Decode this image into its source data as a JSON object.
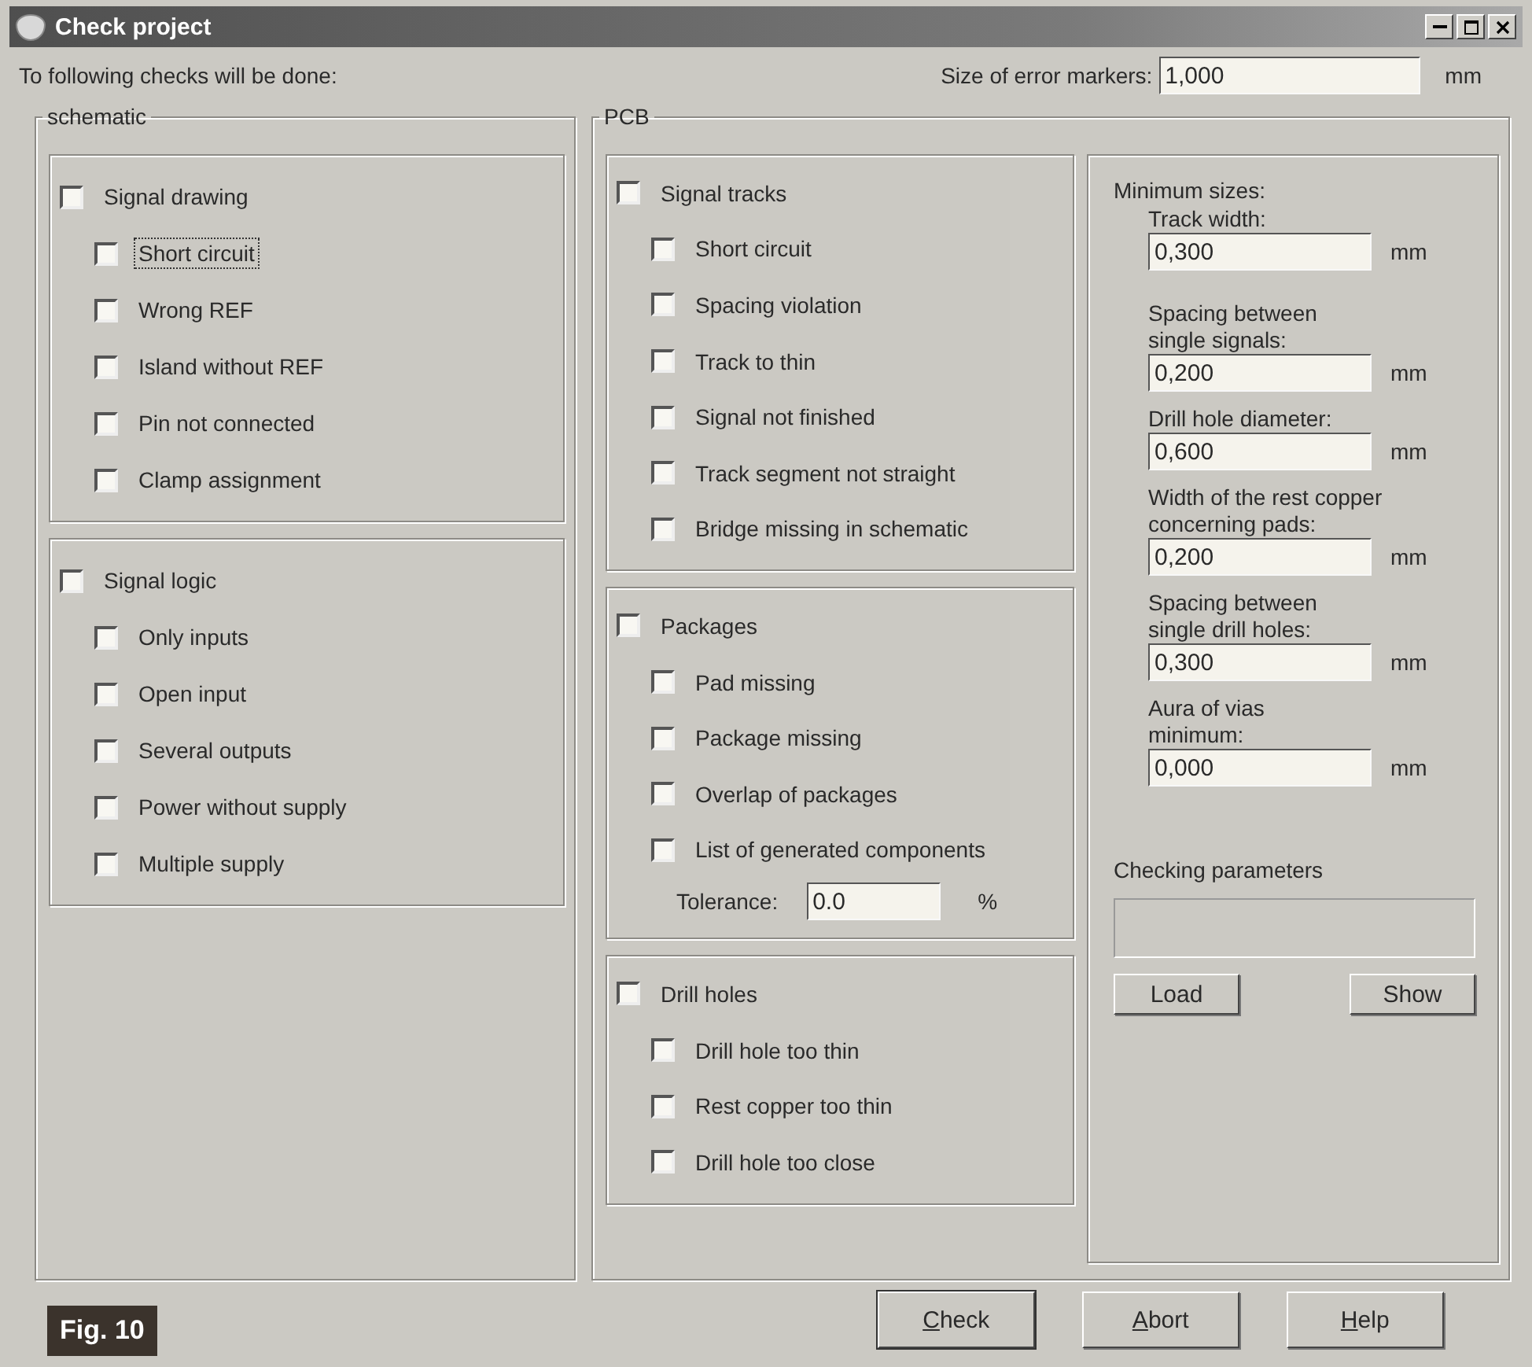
{
  "window": {
    "title": "Check project"
  },
  "intro": "To following checks will be done:",
  "marker_size": {
    "label": "Size of error markers:",
    "value": "1,000",
    "unit": "mm"
  },
  "schematic": {
    "title": "schematic",
    "groups": [
      {
        "label": "Signal drawing",
        "checked": false,
        "items": [
          {
            "label": "Short circuit",
            "checked": false,
            "focused": true
          },
          {
            "label": "Wrong REF",
            "checked": false,
            "focused": false
          },
          {
            "label": "Island without REF",
            "checked": false,
            "focused": false
          },
          {
            "label": "Pin not connected",
            "checked": false,
            "focused": false
          },
          {
            "label": "Clamp assignment",
            "checked": false,
            "focused": false
          }
        ]
      },
      {
        "label": "Signal logic",
        "checked": false,
        "items": [
          {
            "label": "Only inputs",
            "checked": false,
            "focused": false
          },
          {
            "label": "Open input",
            "checked": false,
            "focused": false
          },
          {
            "label": "Several outputs",
            "checked": false,
            "focused": false
          },
          {
            "label": "Power without supply",
            "checked": false,
            "focused": false
          },
          {
            "label": "Multiple supply",
            "checked": false,
            "focused": false
          }
        ]
      }
    ]
  },
  "pcb": {
    "title": "PCB",
    "groups": [
      {
        "label": "Signal tracks",
        "checked": false,
        "items": [
          {
            "label": "Short circuit",
            "checked": false,
            "focused": false
          },
          {
            "label": "Spacing violation",
            "checked": false,
            "focused": false
          },
          {
            "label": "Track to thin",
            "checked": false,
            "focused": false
          },
          {
            "label": "Signal not finished",
            "checked": false,
            "focused": false
          },
          {
            "label": "Track segment not straight",
            "checked": false,
            "focused": false
          },
          {
            "label": "Bridge missing in schematic",
            "checked": false,
            "focused": false
          }
        ]
      },
      {
        "label": "Packages",
        "checked": false,
        "items": [
          {
            "label": "Pad missing",
            "checked": false,
            "focused": false
          },
          {
            "label": "Package missing",
            "checked": false,
            "focused": false
          },
          {
            "label": "Overlap of packages",
            "checked": false,
            "focused": false
          },
          {
            "label": "List of generated components",
            "checked": false,
            "focused": false
          }
        ],
        "tolerance": {
          "label": "Tolerance:",
          "value": "0.0",
          "unit": "%"
        }
      },
      {
        "label": "Drill holes",
        "checked": false,
        "items": [
          {
            "label": "Drill hole too thin",
            "checked": false,
            "focused": false
          },
          {
            "label": "Rest copper too thin",
            "checked": false,
            "focused": false
          },
          {
            "label": "Drill hole too close",
            "checked": false,
            "focused": false
          }
        ]
      }
    ],
    "minimum_sizes": {
      "heading": "Minimum sizes:",
      "fields": [
        {
          "label": "Track width:",
          "value": "0,300",
          "unit": "mm"
        },
        {
          "label": "Spacing between\nsingle signals:",
          "value": "0,200",
          "unit": "mm"
        },
        {
          "label": "Drill hole diameter:",
          "value": "0,600",
          "unit": "mm"
        },
        {
          "label": "Width of the rest copper\nconcerning pads:",
          "value": "0,200",
          "unit": "mm"
        },
        {
          "label": "Spacing between\nsingle drill holes:",
          "value": "0,300",
          "unit": "mm"
        },
        {
          "label": "Aura of vias\nminimum:",
          "value": "0,000",
          "unit": "mm"
        }
      ]
    },
    "checking_parameters": {
      "label": "Checking parameters",
      "buttons": [
        "Load",
        "Show"
      ]
    }
  },
  "buttons": [
    {
      "label": "Check",
      "default": true,
      "mnemonic": true
    },
    {
      "label": "Abort",
      "default": false,
      "mnemonic": true
    },
    {
      "label": "Help",
      "default": false,
      "mnemonic": true
    }
  ],
  "figure_label": "Fig. 10"
}
